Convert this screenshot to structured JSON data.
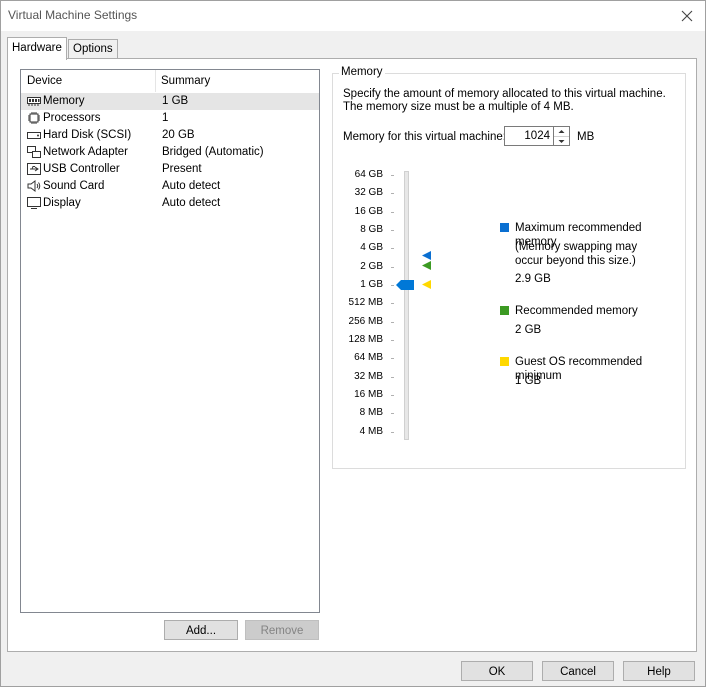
{
  "window": {
    "title": "Virtual Machine Settings"
  },
  "tabs": [
    {
      "label": "Hardware"
    },
    {
      "label": "Options"
    }
  ],
  "device_list": {
    "columns": {
      "device": "Device",
      "summary": "Summary"
    },
    "rows": [
      {
        "device": "Memory",
        "summary": "1 GB",
        "icon": "memory-icon"
      },
      {
        "device": "Processors",
        "summary": "1",
        "icon": "processor-icon"
      },
      {
        "device": "Hard Disk (SCSI)",
        "summary": "20 GB",
        "icon": "hard-disk-icon"
      },
      {
        "device": "Network Adapter",
        "summary": "Bridged (Automatic)",
        "icon": "network-adapter-icon"
      },
      {
        "device": "USB Controller",
        "summary": "Present",
        "icon": "usb-icon"
      },
      {
        "device": "Sound Card",
        "summary": "Auto detect",
        "icon": "speaker-icon"
      },
      {
        "device": "Display",
        "summary": "Auto detect",
        "icon": "monitor-icon"
      }
    ],
    "selected_index": 0
  },
  "list_buttons": {
    "add": "Add...",
    "remove": "Remove"
  },
  "memory": {
    "group_title": "Memory",
    "description": "Specify the amount of memory allocated to this virtual machine. The memory size must be a multiple of 4 MB.",
    "field_label": "Memory for this virtual machine:",
    "value": "1024",
    "unit": "MB",
    "scale": [
      "64 GB",
      "32 GB",
      "16 GB",
      "8 GB",
      "4 GB",
      "2 GB",
      "1 GB",
      "512 MB",
      "256 MB",
      "128 MB",
      "64 MB",
      "32 MB",
      "16 MB",
      "8 MB",
      "4 MB"
    ],
    "legend": {
      "max": {
        "label": "Maximum recommended memory",
        "note": "(Memory swapping may occur beyond this size.)",
        "value": "2.9 GB",
        "color": "#0a6fd1"
      },
      "recommended": {
        "label": "Recommended memory",
        "value": "2 GB",
        "color": "#3c9a23"
      },
      "guest_min": {
        "label": "Guest OS recommended minimum",
        "value": "1 GB",
        "color": "#ffd800"
      }
    },
    "thumb_color": "#0078d7"
  },
  "footer": {
    "ok": "OK",
    "cancel": "Cancel",
    "help": "Help"
  }
}
